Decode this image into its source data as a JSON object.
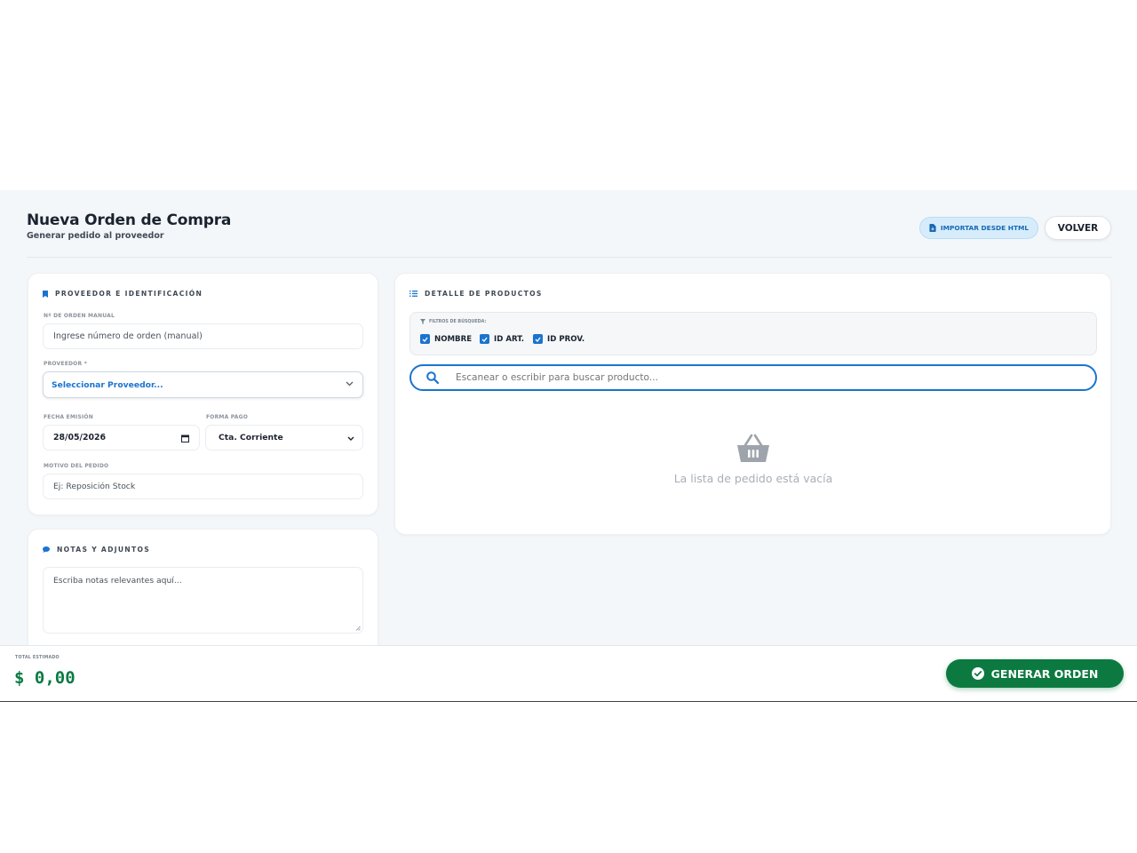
{
  "header": {
    "title": "Nueva Orden de Compra",
    "subtitle": "Generar pedido al proveedor",
    "import_button": "IMPORTAR DESDE HTML",
    "back_button": "VOLVER"
  },
  "provider_card": {
    "title": "PROVEEDOR E IDENTIFICACIÓN",
    "order_number_label": "Nº DE ORDEN MANUAL",
    "order_number_placeholder": "Ingrese número de orden (manual)",
    "provider_label": "PROVEEDOR *",
    "provider_value": "Seleccionar Proveedor...",
    "date_label": "FECHA EMISIÓN",
    "date_value": "28/05/2026",
    "payment_label": "FORMA PAGO",
    "payment_value": "Cta. Corriente",
    "reason_label": "MOTIVO DEL PEDIDO",
    "reason_placeholder": "Ej: Reposición Stock"
  },
  "notes_card": {
    "title": "NOTAS Y ADJUNTOS",
    "notes_placeholder": "Escriba notas relevantes aquí..."
  },
  "products_card": {
    "title": "DETALLE DE PRODUCTOS",
    "filters_label": "FILTROS DE BÚSQUEDA:",
    "filters": [
      {
        "label": "NOMBRE",
        "checked": true
      },
      {
        "label": "ID ART.",
        "checked": true
      },
      {
        "label": "ID PROV.",
        "checked": true
      }
    ],
    "search_placeholder": "Escanear o escribir para buscar producto...",
    "empty_text": "La lista de pedido está vacía"
  },
  "footer": {
    "total_label": "TOTAL ESTIMADO",
    "total_value": "$ 0,00",
    "generate_button": "GENERAR ORDEN"
  },
  "colors": {
    "accent": "#1a74cf",
    "success": "#0c7a40",
    "background": "#f4f7fa"
  },
  "icons": [
    "file-import-icon",
    "bookmark-icon",
    "chevron-down-icon",
    "calendar-icon",
    "list-icon",
    "filter-icon",
    "checkbox-icon",
    "search-icon",
    "basket-icon",
    "comment-icon",
    "resize-handle-icon",
    "check-circle-icon"
  ]
}
